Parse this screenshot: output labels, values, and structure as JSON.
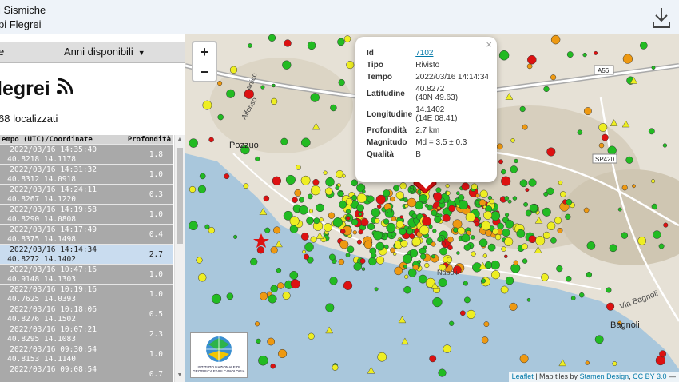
{
  "header": {
    "line1": "i Sismiche",
    "line2": "pi Flegrei"
  },
  "tabs": {
    "tab1": "e",
    "tab2": "Anni disponibili",
    "tab2_caret": "▼"
  },
  "region": {
    "title": "legrei"
  },
  "summary": {
    "count": "68 localizzati"
  },
  "table": {
    "col_time": "empo (UTC)/Coordinate",
    "col_depth": "Profondità",
    "rows": [
      {
        "dt": "2022/03/16 14:35:40",
        "coord": "40.8218 14.1178",
        "depth": "1.8"
      },
      {
        "dt": "2022/03/16 14:31:32",
        "coord": "40.8312 14.0918",
        "depth": "1.0"
      },
      {
        "dt": "2022/03/16 14:24:11",
        "coord": "40.8267 14.1220",
        "depth": "0.3"
      },
      {
        "dt": "2022/03/16 14:19:58",
        "coord": "40.8290 14.0808",
        "depth": "1.0"
      },
      {
        "dt": "2022/03/16 14:17:49",
        "coord": "40.8375 14.1498",
        "depth": "0.4"
      },
      {
        "dt": "2022/03/16 14:14:34",
        "coord": "40.8272 14.1402",
        "depth": "2.7"
      },
      {
        "dt": "2022/03/16 10:47:16",
        "coord": "40.9148 14.1303",
        "depth": "1.0"
      },
      {
        "dt": "2022/03/16 10:19:16",
        "coord": "40.7625 14.0393",
        "depth": "1.0"
      },
      {
        "dt": "2022/03/16 10:18:06",
        "coord": "40.8276 14.1502",
        "depth": "0.5"
      },
      {
        "dt": "2022/03/16 10:07:21",
        "coord": "40.8295 14.1083",
        "depth": "2.3"
      },
      {
        "dt": "2022/03/16 09:30:54",
        "coord": "40.8153 14.1140",
        "depth": "1.0"
      },
      {
        "dt": "2022/03/16 09:08:54",
        "coord": "",
        "depth": "0.7"
      }
    ]
  },
  "map": {
    "zoom_in": "+",
    "zoom_out": "−",
    "labels": {
      "pozzuoli": "Pozzuo",
      "bagnoli": "Bagnoli",
      "via_bagnoli": "Via Bagnoli",
      "a56": "A56",
      "sp420": "SP420",
      "alfonso": "Alfonso",
      "artico": "Artico",
      "napoli": "Napoli"
    },
    "logo_text": "ISTITUTO NAZIONALE DI GEOFISICA E VULCANOLOGIA",
    "attribution": {
      "leaflet": "Leaflet",
      "sep": " | Map tiles by ",
      "stamen": "Stamen Design",
      "comma": ", ",
      "cc": "CC BY 3.0",
      "tail": " —"
    }
  },
  "popup": {
    "close": "×",
    "rows": [
      {
        "k": "Id",
        "v": "7102"
      },
      {
        "k": "Tipo",
        "v": "Rivisto"
      },
      {
        "k": "Tempo",
        "v": "2022/03/16 14:14:34"
      },
      {
        "k": "Latitudine",
        "v": "40.8272",
        "v2": "(40N 49.63)"
      },
      {
        "k": "Longitudine",
        "v": "14.1402",
        "v2": "(14E 08.41)"
      },
      {
        "k": "Profondità",
        "v": "2.7 km"
      },
      {
        "k": "Magnitudo",
        "v": "Md = 3.5 ± 0.3"
      },
      {
        "k": "Qualità",
        "v": "B"
      }
    ]
  },
  "colors": {
    "green": "#22bb22",
    "yellow": "#eeee22",
    "orange": "#ee9911",
    "red": "#dd1111",
    "sea": "#a9c7dc"
  }
}
